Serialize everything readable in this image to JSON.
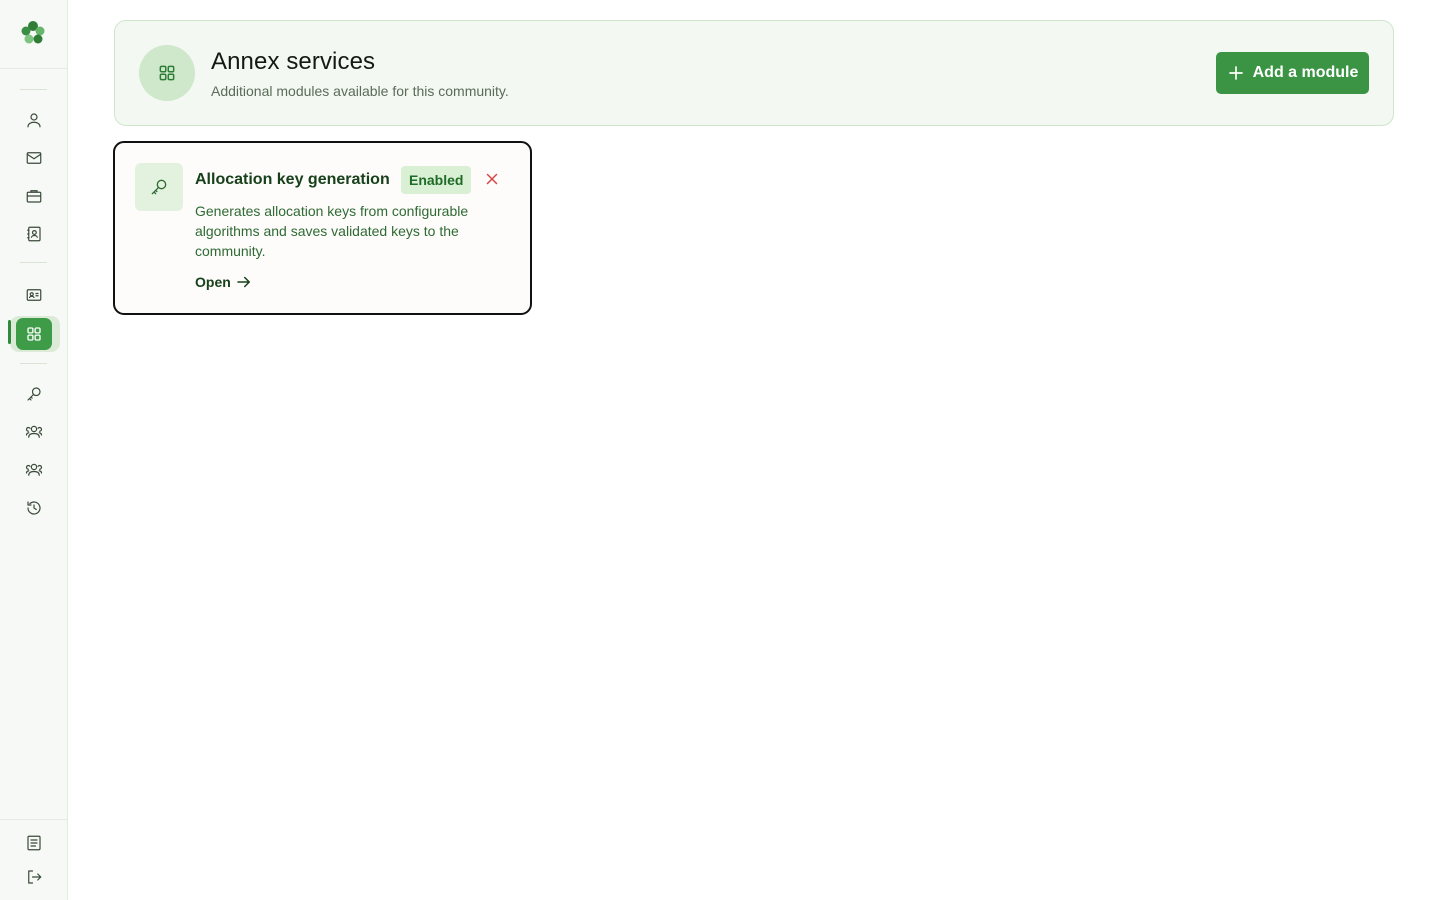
{
  "sidebar": {
    "items": [
      {
        "name": "person-icon"
      },
      {
        "name": "mail-icon"
      },
      {
        "name": "briefcase-icon"
      },
      {
        "name": "contact-book-icon"
      },
      {
        "name": "id-card-icon"
      },
      {
        "name": "grid-icon",
        "active": true
      },
      {
        "name": "key-icon"
      },
      {
        "name": "group-icon"
      },
      {
        "name": "group-icon"
      },
      {
        "name": "history-icon"
      },
      {
        "name": "document-icon"
      },
      {
        "name": "logout-icon"
      }
    ]
  },
  "header": {
    "icon": "grid-icon",
    "title": "Annex services",
    "subtitle": "Additional modules available for this community.",
    "add_button_label": "Add a module"
  },
  "modules": [
    {
      "icon": "key-icon",
      "title": "Allocation key generation",
      "status": "Enabled",
      "description": "Generates allocation keys from configurable algorithms and saves validated keys to the community.",
      "open_label": "Open"
    }
  ],
  "colors": {
    "accent": "#3a9444",
    "header_bg": "#f3f9f2",
    "badge_bg": "#d9f0d4",
    "remove": "#d64545"
  }
}
